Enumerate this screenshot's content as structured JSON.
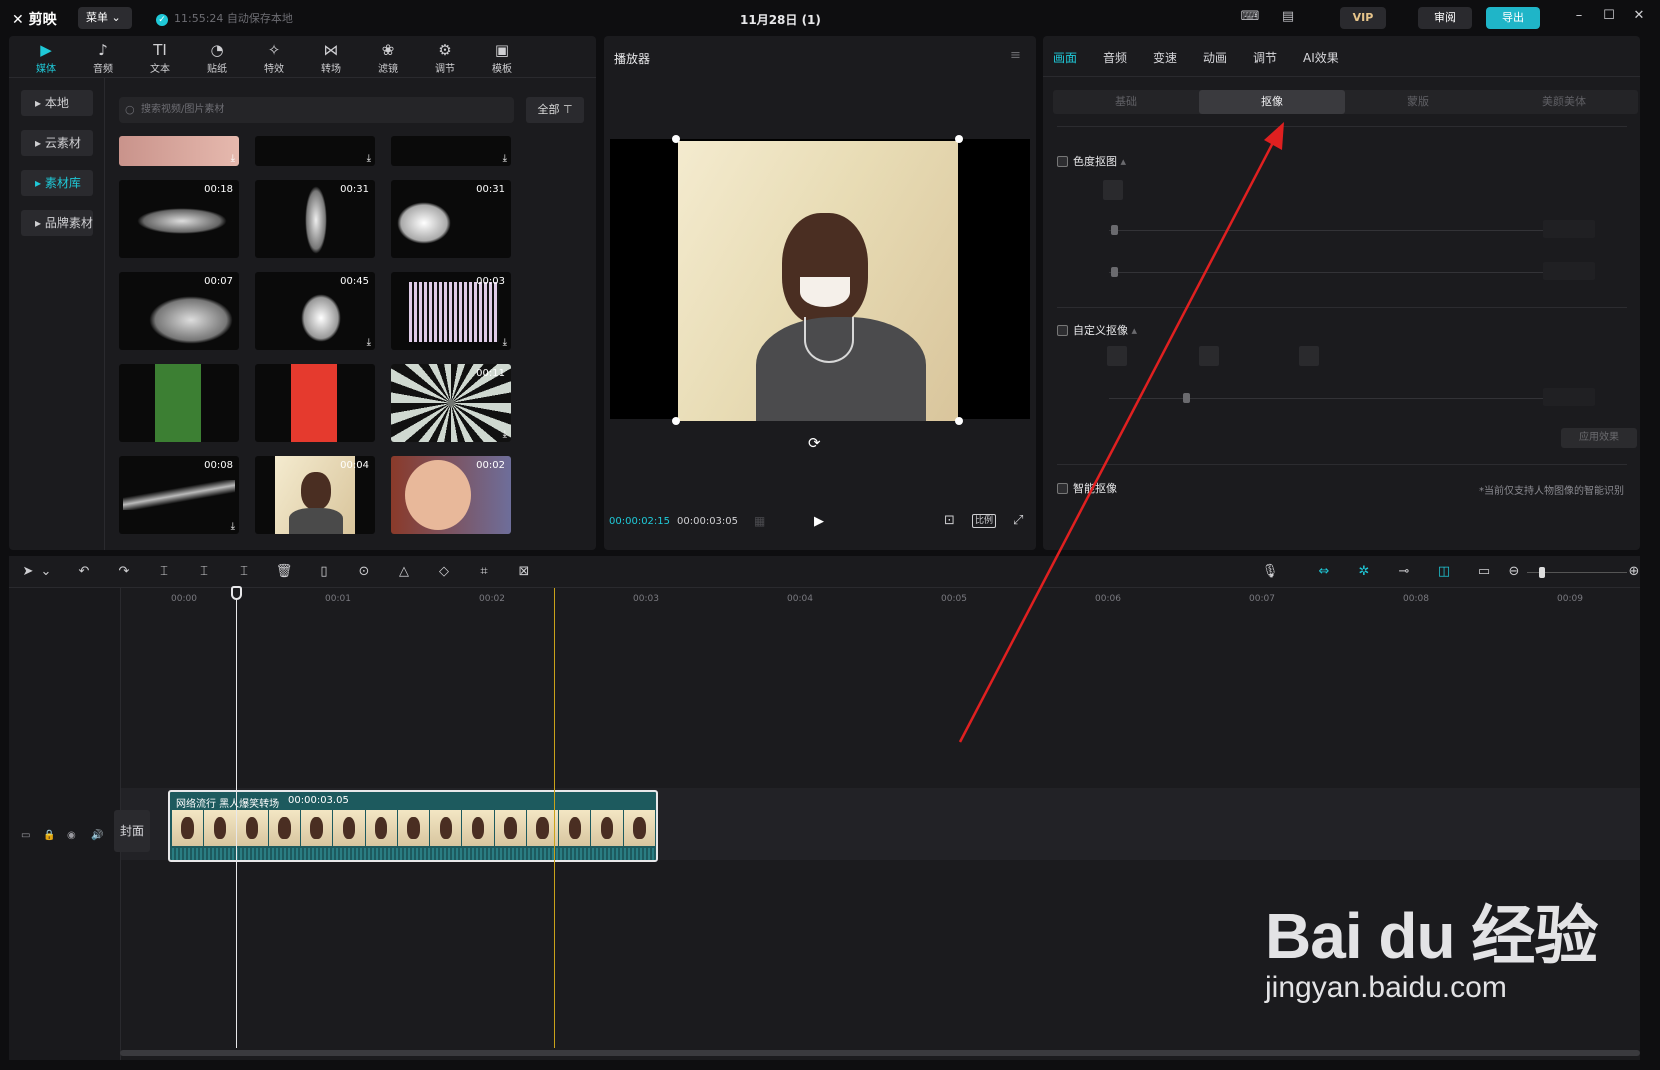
{
  "app": {
    "logo": "剪映",
    "menu_label": "菜单",
    "autosave_text": "11:55:24 自动保存本地",
    "project_title": "11月28日 (1)",
    "vip_label": "VIP",
    "review_label": "审阅",
    "export_label": "导出"
  },
  "tool_tabs": [
    {
      "label": "媒体",
      "icon": "media-icon"
    },
    {
      "label": "音频",
      "icon": "audio-icon"
    },
    {
      "label": "文本",
      "icon": "text-icon"
    },
    {
      "label": "贴纸",
      "icon": "sticker-icon"
    },
    {
      "label": "特效",
      "icon": "effects-icon"
    },
    {
      "label": "转场",
      "icon": "transition-icon"
    },
    {
      "label": "滤镜",
      "icon": "filter-icon"
    },
    {
      "label": "调节",
      "icon": "adjust-icon"
    },
    {
      "label": "模板",
      "icon": "template-icon"
    }
  ],
  "side_nav": [
    "本地",
    "云素材",
    "素材库",
    "品牌素材"
  ],
  "library": {
    "search_placeholder": "搜索视频/图片素材",
    "filter_label": "全部",
    "thumbs": [
      {
        "duration": ""
      },
      {
        "duration": ""
      },
      {
        "duration": ""
      },
      {
        "duration": "00:18"
      },
      {
        "duration": "00:31"
      },
      {
        "duration": "00:31"
      },
      {
        "duration": "00:07"
      },
      {
        "duration": "00:45"
      },
      {
        "duration": "00:03"
      },
      {
        "duration": ""
      },
      {
        "duration": ""
      },
      {
        "duration": "00:11"
      },
      {
        "duration": "00:08"
      },
      {
        "duration": "00:04"
      },
      {
        "duration": "00:02"
      }
    ]
  },
  "player": {
    "title": "播放器",
    "current_time": "00:00:02:15",
    "total_time": "00:00:03:05",
    "ratio_label": "比例"
  },
  "props": {
    "tabs": [
      "画面",
      "音频",
      "变速",
      "动画",
      "调节",
      "AI效果"
    ],
    "subtabs": [
      "基础",
      "抠像",
      "蒙版",
      "美颜美体"
    ],
    "chroma_key": "色度抠图",
    "custom_key": "自定义抠像",
    "smart_key": "智能抠像",
    "apply_label": "应用效果",
    "note": "*当前仅支持人物图像的智能识别"
  },
  "timeline": {
    "ruler": [
      "00:00",
      "00:01",
      "00:02",
      "00:03",
      "00:04",
      "00:05",
      "00:06",
      "00:07",
      "00:08",
      "00:09"
    ],
    "cover_label": "封面",
    "clip_name": "网络流行 黑人爆笑转场",
    "clip_duration": "00:00:03.05"
  },
  "watermark": {
    "brand": "Bai du 经验",
    "url": "jingyan.baidu.com"
  },
  "colors": {
    "accent": "#1fc9d8",
    "panel": "#1b1b1e",
    "background": "#0e0e10",
    "playhead_marker": "#c9a21a",
    "annotation_arrow": "#e02020"
  }
}
